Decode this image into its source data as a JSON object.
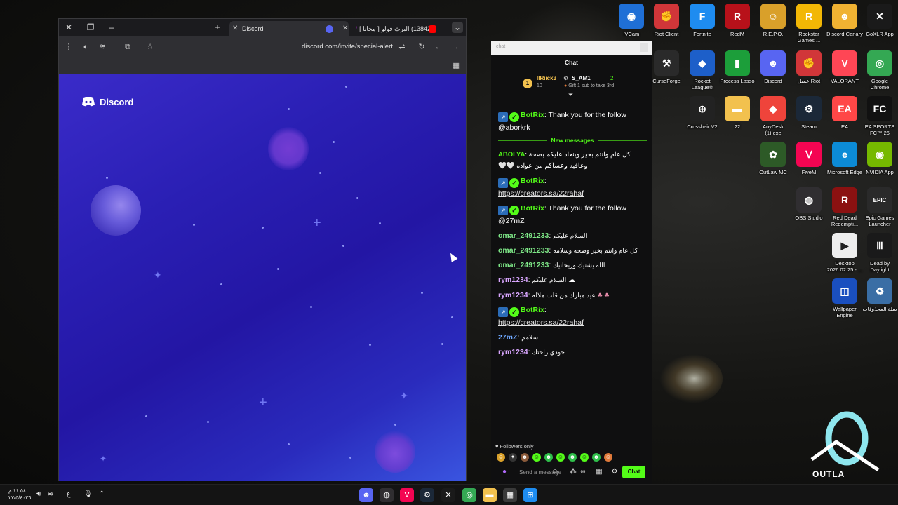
{
  "browser": {
    "tabs": [
      {
        "title": "Discord"
      },
      {
        "title": "(13842) البرث فولو [ مجانا ] 💜"
      }
    ],
    "url": "discord.com/invite/special-alert",
    "page": {
      "brand": "Discord"
    }
  },
  "chat": {
    "search_placeholder": "chat",
    "header_title": "Chat",
    "gifters": {
      "rank": "1",
      "top_name": "lIRiick3",
      "top_count": "10",
      "second_name": "S_AM1",
      "second_count": "2",
      "hint": "Gift 1 sub to take 3rd"
    },
    "new_messages_label": "New messages",
    "colors": {
      "kick_green": "#53fc18",
      "bot_blue": "#2b6cb8"
    },
    "messages": [
      {
        "user": "BotRix",
        "color": "#53fc18",
        "text": "Thank you for the follow @aborkrk",
        "bot": true
      },
      {
        "user": "ABOLYA",
        "color": "#53fc18",
        "text": "كل عام وانتم بخير وينعاد عليكم بصحة وعافيه وعساكم من عواده 🤍🤍"
      },
      {
        "user": "BotRix",
        "color": "#53fc18",
        "text": "https://creators.sa/22rahaf",
        "bot": true,
        "link": true
      },
      {
        "user": "BotRix",
        "color": "#53fc18",
        "text": "Thank you for the follow @27mZ",
        "bot": true
      },
      {
        "user": "omar_2491233",
        "color": "#7ee787",
        "text": "السلام عليكم"
      },
      {
        "user": "omar_2491233",
        "color": "#7ee787",
        "text": "كل عام وانتم بخير وصحه وسلامه"
      },
      {
        "user": "omar_2491233",
        "color": "#7ee787",
        "text": "الله يشنيك وريحانيك"
      },
      {
        "user": "rym1234",
        "color": "#d9a6ff",
        "text": "السلام عليكم"
      },
      {
        "user": "rym1234",
        "color": "#d9a6ff",
        "text": "عيد مبارك من قلب هلاله"
      },
      {
        "user": "BotRix",
        "color": "#53fc18",
        "text": "https://creators.sa/22rahaf",
        "bot": true,
        "link": true
      },
      {
        "user": "27mZ",
        "color": "#6ea8ff",
        "text": "سلامم"
      },
      {
        "user": "rym1234",
        "color": "#d9a6ff",
        "text": "خوذي راحتك"
      }
    ],
    "footer": {
      "followers_only": "Followers only",
      "send_placeholder": "Send a message",
      "chat_button": "Chat"
    }
  },
  "desktop_icons": [
    {
      "label": "iVCam",
      "icon": "camera-icon",
      "color": "#1f6fd6",
      "glyph": "◉"
    },
    {
      "label": "Riot Client",
      "icon": "riot-icon",
      "color": "#d13639",
      "glyph": "✊"
    },
    {
      "label": "Fortnite",
      "icon": "fortnite-icon",
      "color": "#1e8cf0",
      "glyph": "F"
    },
    {
      "label": "RedM",
      "icon": "redm-icon",
      "color": "#b8111a",
      "glyph": "R"
    },
    {
      "label": "R.E.P.O.",
      "icon": "repo-icon",
      "color": "#d9a02a",
      "glyph": "☺"
    },
    {
      "label": "Rockstar Games ...",
      "icon": "rockstar-icon",
      "color": "#f2b705",
      "glyph": "R"
    },
    {
      "label": "Discord Canary",
      "icon": "discord-canary-icon",
      "color": "#f0b232",
      "glyph": "☻"
    },
    {
      "label": "GoXLR App",
      "icon": "goxlr-icon",
      "color": "#1a1a1a",
      "glyph": "✕"
    },
    {
      "label": "CurseForge",
      "icon": "curseforge-icon",
      "color": "#2a2a2a",
      "glyph": "⚒"
    },
    {
      "label": "Rocket League®",
      "icon": "rocket-league-icon",
      "color": "#1d5fc9",
      "glyph": "◆"
    },
    {
      "label": "Process Lasso",
      "icon": "process-lasso-icon",
      "color": "#1c9e3a",
      "glyph": "▮"
    },
    {
      "label": "Discord",
      "icon": "discord-icon",
      "color": "#5865f2",
      "glyph": "☻"
    },
    {
      "label": "عميل Riot",
      "icon": "riot-client-icon",
      "color": "#d13639",
      "glyph": "✊"
    },
    {
      "label": "VALORANT",
      "icon": "valorant-icon",
      "color": "#ff4655",
      "glyph": "V"
    },
    {
      "label": "Google Chrome",
      "icon": "chrome-icon",
      "color": "#34a853",
      "glyph": "◎"
    },
    {
      "label": "Crosshair V2",
      "icon": "crosshair-icon",
      "color": "#222",
      "glyph": "⊕"
    },
    {
      "label": "22",
      "icon": "folder-icon",
      "color": "#f2c14e",
      "glyph": "▬"
    },
    {
      "label": "AnyDesk (1).exe",
      "icon": "anydesk-icon",
      "color": "#ef443b",
      "glyph": "◆"
    },
    {
      "label": "Steam",
      "icon": "steam-icon",
      "color": "#1b2838",
      "glyph": "⚙"
    },
    {
      "label": "EA",
      "icon": "ea-icon",
      "color": "#ff4747",
      "glyph": "EA"
    },
    {
      "label": "EA SPORTS FC™ 26",
      "icon": "easports-icon",
      "color": "#111",
      "glyph": "FC"
    },
    {
      "label": "OutLaw MC",
      "icon": "outlaw-icon",
      "color": "#2d5a27",
      "glyph": "✿"
    },
    {
      "label": "FiveM",
      "icon": "fivem-icon",
      "color": "#f40552",
      "glyph": "Ⅴ"
    },
    {
      "label": "Microsoft Edge",
      "icon": "edge-icon",
      "color": "#0c8bd6",
      "glyph": "e"
    },
    {
      "label": "NVIDIA App",
      "icon": "nvidia-icon",
      "color": "#76b900",
      "glyph": "◉"
    },
    {
      "label": "OBS Studio",
      "icon": "obs-icon",
      "color": "#302e31",
      "glyph": "◍"
    },
    {
      "label": "Red Dead Redempti...",
      "icon": "rdr-icon",
      "color": "#8b1111",
      "glyph": "R"
    },
    {
      "label": "Epic Games Launcher",
      "icon": "epic-icon",
      "color": "#2a2a2a",
      "glyph": "EPIC"
    },
    {
      "label": "Desktop 2026.02.25 - ...",
      "icon": "video-file-icon",
      "color": "#eeeeee",
      "glyph": "▶"
    },
    {
      "label": "Dead by Daylight",
      "icon": "dbd-icon",
      "color": "#1a1a1a",
      "glyph": "Ⅲ"
    },
    {
      "label": "Wallpaper Engine",
      "icon": "wallpaper-engine-icon",
      "color": "#1a4fbf",
      "glyph": "◫"
    },
    {
      "label": "سلة المحذوفات",
      "icon": "recycle-bin-icon",
      "color": "#3a6ea5",
      "glyph": "♻"
    }
  ],
  "outla": {
    "text": "OUTLA"
  },
  "taskbar": {
    "clock_time": "١١:٥٨ م",
    "clock_date": "٢٧/٥/٤٠٢٦",
    "apps": [
      {
        "icon": "discord-icon",
        "color": "#5865f2",
        "glyph": "☻"
      },
      {
        "icon": "obs-icon",
        "color": "#302e31",
        "glyph": "◍"
      },
      {
        "icon": "fivem-icon",
        "color": "#f40552",
        "glyph": "Ⅴ"
      },
      {
        "icon": "steam-icon",
        "color": "#1b2838",
        "glyph": "⚙"
      },
      {
        "icon": "goxlr-icon",
        "color": "#1a1a1a",
        "glyph": "✕"
      },
      {
        "icon": "chrome-icon",
        "color": "#34a853",
        "glyph": "◎"
      },
      {
        "icon": "file-explorer-icon",
        "color": "#f2c14e",
        "glyph": "▬"
      },
      {
        "icon": "store-icon",
        "color": "#3a3a3a",
        "glyph": "▦"
      },
      {
        "icon": "windows-start-icon",
        "color": "#1e8cf0",
        "glyph": "⊞"
      }
    ]
  }
}
